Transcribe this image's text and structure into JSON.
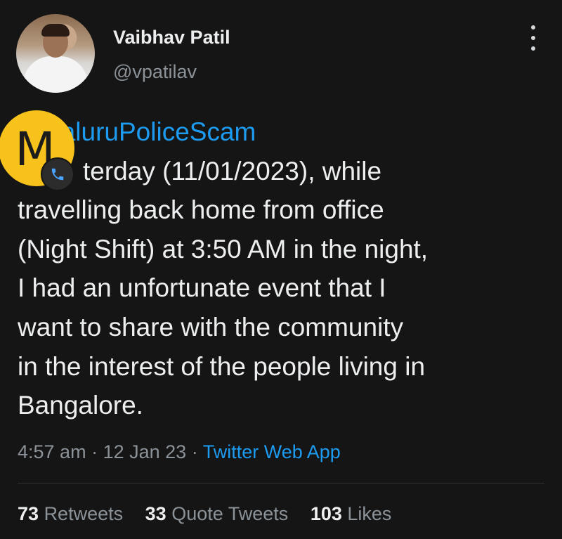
{
  "author": {
    "name": "Vaibhav Patil",
    "handle": "@vpatilav"
  },
  "tweet": {
    "mention": "#BengaluruPoliceScam",
    "mention_visible": "engaluruPoliceScam",
    "line1_visible": "terday (11/01/2023), while",
    "lines": [
      "travelling back home from office",
      "(Night Shift) at 3:50 AM in the night,",
      "I had an unfortunate event that I",
      "want to share with the community",
      "in the interest of the people living in",
      "Bangalore."
    ]
  },
  "overlay": {
    "bubble_letter": "M",
    "badge_icon": "phone-icon",
    "bubble_color": "#f7c21b"
  },
  "meta": {
    "time": "4:57 am",
    "separator": "·",
    "date": "12 Jan 23",
    "source": "Twitter Web App"
  },
  "stats": {
    "retweets_count": "73",
    "retweets_label": "Retweets",
    "quotes_count": "33",
    "quotes_label": "Quote Tweets",
    "likes_count": "103",
    "likes_label": "Likes"
  },
  "colors": {
    "background": "#151515",
    "link": "#1d9bf0",
    "secondary_text": "#8b9298"
  }
}
